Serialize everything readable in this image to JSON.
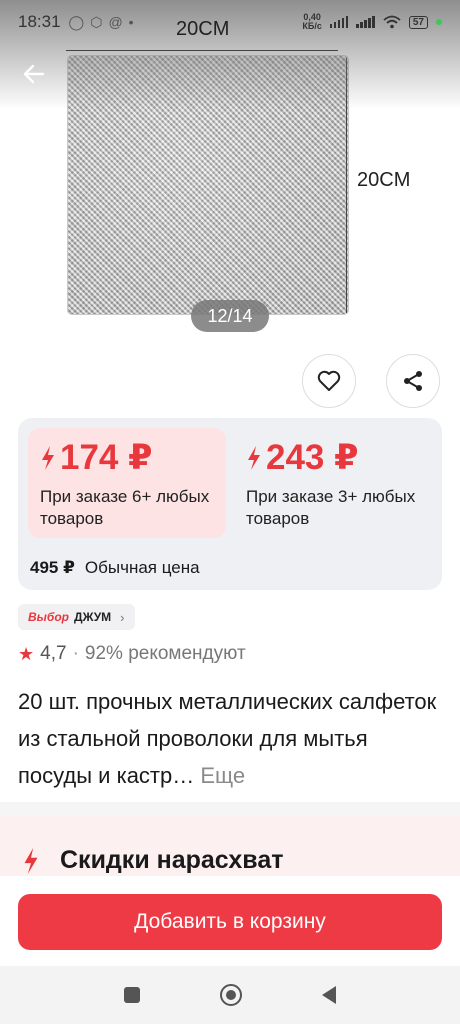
{
  "status_bar": {
    "time": "18:31",
    "net_speed_value": "0,40",
    "net_speed_unit": "КБ/с",
    "battery": "57",
    "left_icons": [
      "whatsapp-icon",
      "box-icon",
      "at-icon",
      "dot-icon"
    ]
  },
  "gallery": {
    "dimension_top": "20CM",
    "dimension_right": "20CM",
    "counter": "12/14"
  },
  "prices": {
    "options": [
      {
        "price": "174 ₽",
        "condition": "При заказе 6+ любых товаров"
      },
      {
        "price": "243 ₽",
        "condition": "При заказе 3+ любых товаров"
      }
    ],
    "regular_price": "495 ₽",
    "regular_label": "Обычная цена"
  },
  "badge": {
    "brand": "Выбор",
    "name": "ДЖУМ"
  },
  "rating": {
    "value": "4,7",
    "recommend": "92% рекомендуют"
  },
  "product": {
    "title": "20 шт. прочных металлических салфеток из стальной проволоки для мытья посуды и кастр…",
    "more": "Еще"
  },
  "flash_sale": {
    "title": "Скидки нарасхват"
  },
  "cart": {
    "button": "Добавить в корзину"
  },
  "colors": {
    "accent": "#ee3a45",
    "price_red": "#e8383d",
    "active_option_bg": "#fde3e4"
  }
}
